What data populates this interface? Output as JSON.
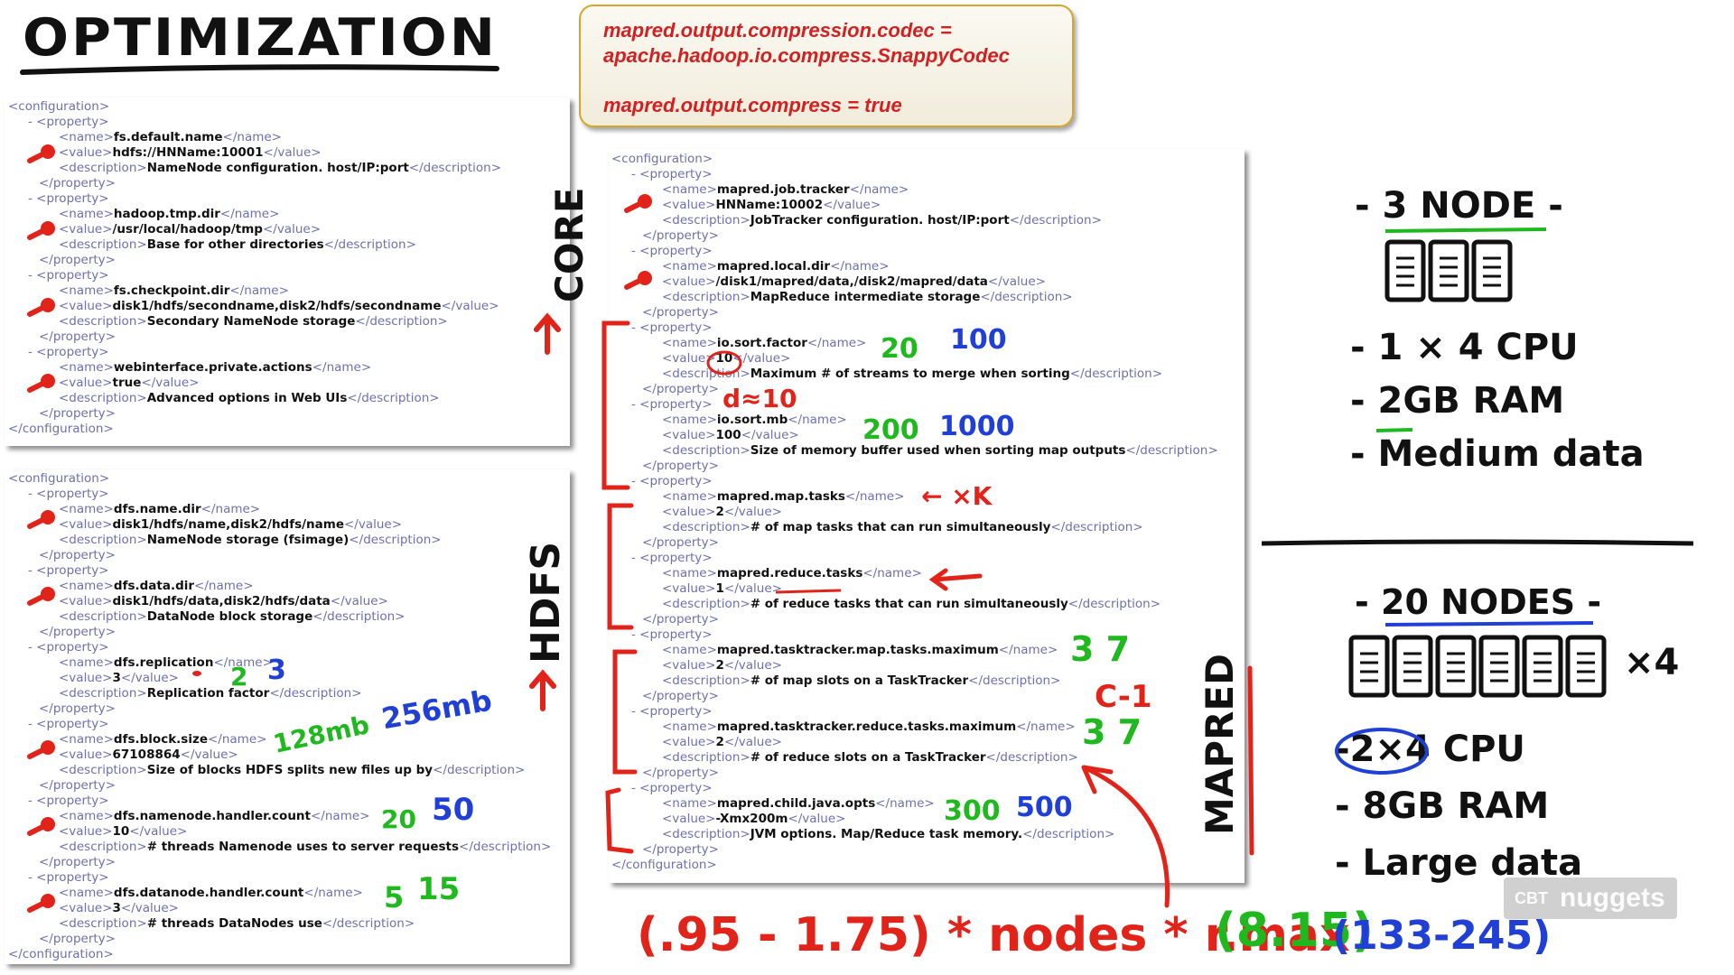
{
  "title": "OPTIMIZATION",
  "callout": {
    "line1": "mapred.output.compression.codec =",
    "line2": "apache.hadoop.io.compress.SnappyCodec",
    "line3": "mapred.output.compress = true"
  },
  "core_xml": [
    {
      "i": 0,
      "o": "configuration"
    },
    {
      "i": 1,
      "d": true,
      "o": "property"
    },
    {
      "i": 2,
      "f": "name",
      "v": "fs.default.name"
    },
    {
      "i": 2,
      "f": "value",
      "v": "hdfs://HNName:10001"
    },
    {
      "i": 2,
      "f": "description",
      "v": "NameNode configuration. host/IP:port"
    },
    {
      "i": 1,
      "c": "property"
    },
    {
      "i": 1,
      "d": true,
      "o": "property"
    },
    {
      "i": 2,
      "f": "name",
      "v": "hadoop.tmp.dir"
    },
    {
      "i": 2,
      "f": "value",
      "v": "/usr/local/hadoop/tmp"
    },
    {
      "i": 2,
      "f": "description",
      "v": "Base for other directories"
    },
    {
      "i": 1,
      "c": "property"
    },
    {
      "i": 1,
      "d": true,
      "o": "property"
    },
    {
      "i": 2,
      "f": "name",
      "v": "fs.checkpoint.dir"
    },
    {
      "i": 2,
      "f": "value",
      "v": "disk1/hdfs/secondname,disk2/hdfs/secondname"
    },
    {
      "i": 2,
      "f": "description",
      "v": "Secondary NameNode storage"
    },
    {
      "i": 1,
      "c": "property"
    },
    {
      "i": 1,
      "d": true,
      "o": "property"
    },
    {
      "i": 2,
      "f": "name",
      "v": "webinterface.private.actions"
    },
    {
      "i": 2,
      "f": "value",
      "v": "true"
    },
    {
      "i": 2,
      "f": "description",
      "v": "Advanced options in Web UIs"
    },
    {
      "i": 1,
      "c": "property"
    },
    {
      "i": 0,
      "c": "configuration"
    }
  ],
  "hdfs_xml": [
    {
      "i": 0,
      "o": "configuration"
    },
    {
      "i": 1,
      "d": true,
      "o": "property"
    },
    {
      "i": 2,
      "f": "name",
      "v": "dfs.name.dir"
    },
    {
      "i": 2,
      "f": "value",
      "v": "disk1/hdfs/name,disk2/hdfs/name"
    },
    {
      "i": 2,
      "f": "description",
      "v": "NameNode storage (fsimage)"
    },
    {
      "i": 1,
      "c": "property"
    },
    {
      "i": 1,
      "d": true,
      "o": "property"
    },
    {
      "i": 2,
      "f": "name",
      "v": "dfs.data.dir"
    },
    {
      "i": 2,
      "f": "value",
      "v": "disk1/hdfs/data,disk2/hdfs/data"
    },
    {
      "i": 2,
      "f": "description",
      "v": "DataNode block storage"
    },
    {
      "i": 1,
      "c": "property"
    },
    {
      "i": 1,
      "d": true,
      "o": "property"
    },
    {
      "i": 2,
      "f": "name",
      "v": "dfs.replication"
    },
    {
      "i": 2,
      "f": "value",
      "v": "3"
    },
    {
      "i": 2,
      "f": "description",
      "v": "Replication factor"
    },
    {
      "i": 1,
      "c": "property"
    },
    {
      "i": 1,
      "d": true,
      "o": "property"
    },
    {
      "i": 2,
      "f": "name",
      "v": "dfs.block.size"
    },
    {
      "i": 2,
      "f": "value",
      "v": "67108864"
    },
    {
      "i": 2,
      "f": "description",
      "v": "Size of blocks HDFS splits new files up by"
    },
    {
      "i": 1,
      "c": "property"
    },
    {
      "i": 1,
      "d": true,
      "o": "property"
    },
    {
      "i": 2,
      "f": "name",
      "v": "dfs.namenode.handler.count"
    },
    {
      "i": 2,
      "f": "value",
      "v": "10"
    },
    {
      "i": 2,
      "f": "description",
      "v": "# threads Namenode uses to server requests"
    },
    {
      "i": 1,
      "c": "property"
    },
    {
      "i": 1,
      "d": true,
      "o": "property"
    },
    {
      "i": 2,
      "f": "name",
      "v": "dfs.datanode.handler.count"
    },
    {
      "i": 2,
      "f": "value",
      "v": "3"
    },
    {
      "i": 2,
      "f": "description",
      "v": "# threads DataNodes use"
    },
    {
      "i": 1,
      "c": "property"
    },
    {
      "i": 0,
      "c": "configuration"
    }
  ],
  "mapred_xml": [
    {
      "i": 0,
      "o": "configuration"
    },
    {
      "i": 1,
      "d": true,
      "o": "property"
    },
    {
      "i": 2,
      "f": "name",
      "v": "mapred.job.tracker"
    },
    {
      "i": 2,
      "f": "value",
      "v": "HNName:10002"
    },
    {
      "i": 2,
      "f": "description",
      "v": "JobTracker configuration. host/IP:port"
    },
    {
      "i": 1,
      "c": "property"
    },
    {
      "i": 1,
      "d": true,
      "o": "property"
    },
    {
      "i": 2,
      "f": "name",
      "v": "mapred.local.dir"
    },
    {
      "i": 2,
      "f": "value",
      "v": "/disk1/mapred/data,/disk2/mapred/data"
    },
    {
      "i": 2,
      "f": "description",
      "v": "MapReduce intermediate storage"
    },
    {
      "i": 1,
      "c": "property"
    },
    {
      "i": 1,
      "d": true,
      "o": "property"
    },
    {
      "i": 2,
      "f": "name",
      "v": "io.sort.factor"
    },
    {
      "i": 2,
      "f": "value",
      "v": "10"
    },
    {
      "i": 2,
      "f": "description",
      "v": "Maximum # of streams to merge when sorting"
    },
    {
      "i": 1,
      "c": "property"
    },
    {
      "i": 1,
      "d": true,
      "o": "property"
    },
    {
      "i": 2,
      "f": "name",
      "v": "io.sort.mb"
    },
    {
      "i": 2,
      "f": "value",
      "v": "100"
    },
    {
      "i": 2,
      "f": "description",
      "v": "Size of memory buffer used when sorting map outputs"
    },
    {
      "i": 1,
      "c": "property"
    },
    {
      "i": 1,
      "d": true,
      "o": "property"
    },
    {
      "i": 2,
      "f": "name",
      "v": "mapred.map.tasks"
    },
    {
      "i": 2,
      "f": "value",
      "v": "2"
    },
    {
      "i": 2,
      "f": "description",
      "v": "# of map tasks that can run simultaneously"
    },
    {
      "i": 1,
      "c": "property"
    },
    {
      "i": 1,
      "d": true,
      "o": "property"
    },
    {
      "i": 2,
      "f": "name",
      "v": "mapred.reduce.tasks"
    },
    {
      "i": 2,
      "f": "value",
      "v": "1"
    },
    {
      "i": 2,
      "f": "description",
      "v": "# of reduce tasks that can run simultaneously"
    },
    {
      "i": 1,
      "c": "property"
    },
    {
      "i": 1,
      "d": true,
      "o": "property"
    },
    {
      "i": 2,
      "f": "name",
      "v": "mapred.tasktracker.map.tasks.maximum"
    },
    {
      "i": 2,
      "f": "value",
      "v": "2"
    },
    {
      "i": 2,
      "f": "description",
      "v": "# of map slots on a TaskTracker"
    },
    {
      "i": 1,
      "c": "property"
    },
    {
      "i": 1,
      "d": true,
      "o": "property"
    },
    {
      "i": 2,
      "f": "name",
      "v": "mapred.tasktracker.reduce.tasks.maximum"
    },
    {
      "i": 2,
      "f": "value",
      "v": "2"
    },
    {
      "i": 2,
      "f": "description",
      "v": "# of reduce slots on a TaskTracker"
    },
    {
      "i": 1,
      "c": "property"
    },
    {
      "i": 1,
      "d": true,
      "o": "property"
    },
    {
      "i": 2,
      "f": "name",
      "v": "mapred.child.java.opts"
    },
    {
      "i": 2,
      "f": "value",
      "v": "-Xmx200m"
    },
    {
      "i": 2,
      "f": "description",
      "v": "JVM options. Map/Reduce task memory."
    },
    {
      "i": 1,
      "c": "property"
    },
    {
      "i": 0,
      "c": "configuration"
    }
  ],
  "side_labels": {
    "core": "CORE",
    "hdfs": "HDFS",
    "mapred": "MAPRED"
  },
  "annotations": {
    "sort_factor": [
      "20",
      "100"
    ],
    "sort_factor_note": "d≈10",
    "sort_mb": [
      "200",
      "1000"
    ],
    "map_tasks_note": "← ×K",
    "replication": [
      "2",
      "3"
    ],
    "block_size": [
      "128mb",
      "256mb"
    ],
    "namenode_handler": [
      "20",
      "50"
    ],
    "datanode_handler": [
      "5",
      "15"
    ],
    "map_max": "3 7",
    "reduce_max": "3 7",
    "slot_note": "C-1",
    "java_opts": [
      "300",
      "500"
    ]
  },
  "small_cluster": {
    "header": "- 3 NODE -",
    "specs": [
      "- 1 × 4 CPU",
      "- 2GB RAM",
      "- Medium data"
    ],
    "server_count": 3
  },
  "large_cluster": {
    "header": "- 20 NODES -",
    "multiplier": "×4",
    "specs": [
      "-2×4 CPU",
      "- 8GB RAM",
      "- Large data"
    ],
    "server_count": 6
  },
  "formula": {
    "text": "(.95 - 1.75) * nodes * r.max",
    "paren": "(8.15)",
    "result": "(133-245)"
  },
  "colors": {
    "red": "#e2231a",
    "green": "#1fb81f",
    "blue": "#1f3fd6",
    "black": "#111111"
  },
  "watermark": {
    "cbt": "CBT",
    "brand": "nuggets"
  }
}
